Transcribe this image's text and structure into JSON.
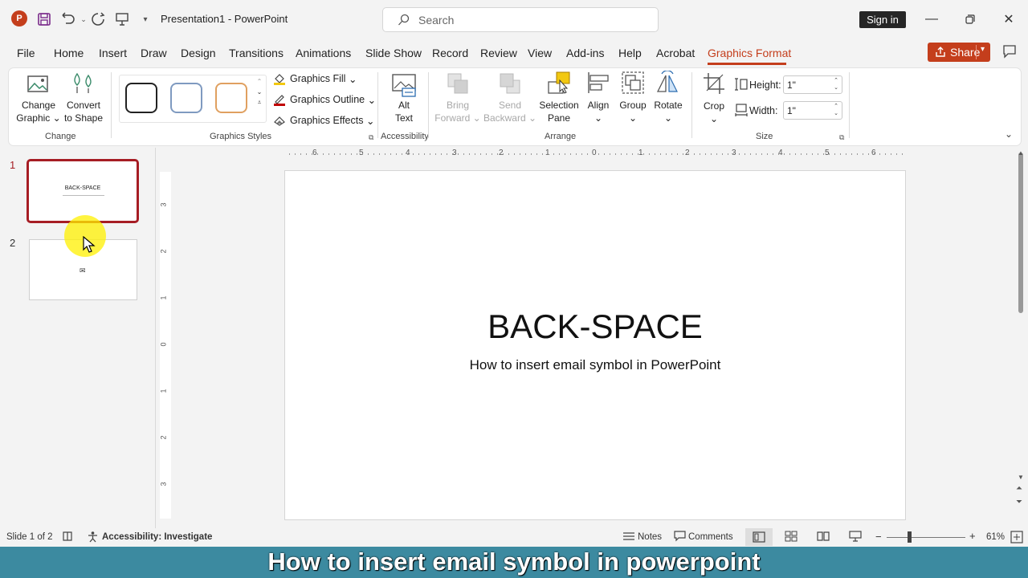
{
  "titlebar": {
    "doc_title": "Presentation1  -  PowerPoint",
    "search_placeholder": "Search",
    "signin": "Sign in"
  },
  "tabs": [
    "File",
    "Home",
    "Insert",
    "Draw",
    "Design",
    "Transitions",
    "Animations",
    "Slide Show",
    "Record",
    "Review",
    "View",
    "Add-ins",
    "Help",
    "Acrobat",
    "Graphics Format"
  ],
  "active_tab": "Graphics Format",
  "share_label": "Share",
  "ribbon": {
    "change_graphic": [
      "Change",
      "Graphic"
    ],
    "convert_shape": [
      "Convert",
      "to Shape"
    ],
    "group_change": "Change",
    "graphics_fill": "Graphics Fill",
    "graphics_outline": "Graphics Outline",
    "graphics_effects": "Graphics Effects",
    "group_styles": "Graphics Styles",
    "alt_text": [
      "Alt",
      "Text"
    ],
    "group_accessibility": "Accessibility",
    "bring_forward": [
      "Bring",
      "Forward"
    ],
    "send_backward": [
      "Send",
      "Backward"
    ],
    "selection_pane": [
      "Selection",
      "Pane"
    ],
    "align": "Align",
    "group_btn": "Group",
    "rotate": "Rotate",
    "group_arrange": "Arrange",
    "crop": "Crop",
    "height_label": "Height:",
    "height_value": "1\"",
    "width_label": "Width:",
    "width_value": "1\"",
    "group_size": "Size"
  },
  "slides": {
    "nums": [
      "1",
      "2"
    ],
    "thumb1_title": "BACK-SPACE"
  },
  "slide": {
    "title": "BACK-SPACE",
    "subtitle": "How to insert email symbol in PowerPoint"
  },
  "ruler_h": [
    "6",
    "5",
    "4",
    "3",
    "2",
    "1",
    "0",
    "1",
    "2",
    "3",
    "4",
    "5",
    "6"
  ],
  "ruler_v": [
    "3",
    "2",
    "1",
    "0",
    "1",
    "2",
    "3"
  ],
  "status": {
    "slide_info": "Slide 1 of 2",
    "accessibility": "Accessibility: Investigate",
    "notes": "Notes",
    "comments": "Comments",
    "zoom": "61%"
  },
  "caption": "How to insert email symbol in powerpoint",
  "colors": {
    "accent": "#c43e1c",
    "caption_bg": "#3c8aa0",
    "selected_thumb": "#a61d24"
  }
}
